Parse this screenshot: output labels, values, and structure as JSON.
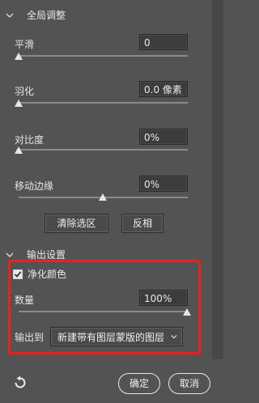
{
  "global_adjust": {
    "title": "全局调整",
    "smooth": {
      "label": "平滑",
      "value": "0",
      "level": 0
    },
    "feather": {
      "label": "羽化",
      "value": "0.0 像素",
      "level": 0
    },
    "contrast": {
      "label": "对比度",
      "value": "0%",
      "level": 0
    },
    "shift_edge": {
      "label": "移动边缘",
      "value": "0%",
      "level": 0.5
    },
    "clear_selection_label": "清除选区",
    "invert_label": "反相"
  },
  "output": {
    "title": "输出设置",
    "decontaminate": {
      "label": "净化颜色",
      "checked": true
    },
    "amount": {
      "label": "数量",
      "value": "100%",
      "level": 1
    },
    "output_to": {
      "label": "输出到",
      "selected": "新建带有图层蒙版的图层"
    }
  },
  "footer": {
    "ok_label": "确定",
    "cancel_label": "取消"
  },
  "colors": {
    "panel_bg": "#535353",
    "highlight": "#e8231f"
  },
  "icons": {
    "chevron": "chevron-down-icon",
    "reset": "reset-arrow-icon",
    "check": "checkmark-icon",
    "dropdown": "chevron-down-icon"
  }
}
